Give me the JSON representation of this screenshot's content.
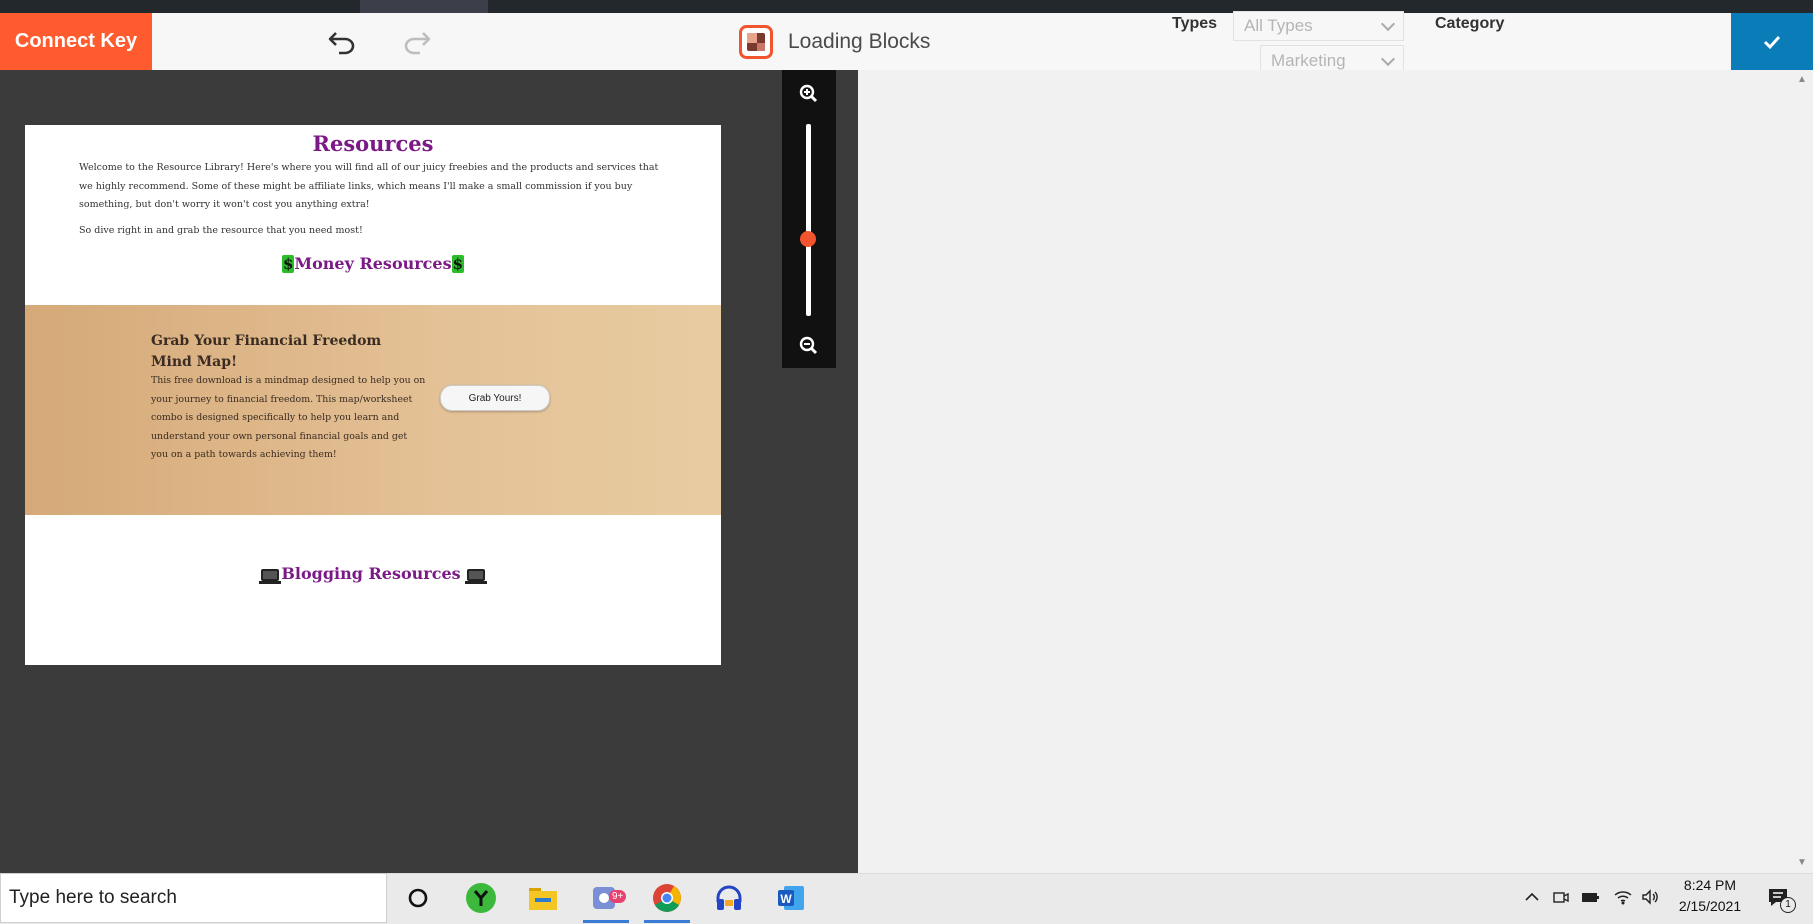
{
  "toolbar": {
    "connect_label": "Connect Key",
    "title": "Loading Blocks",
    "types_label": "Types",
    "types_value": "All Types",
    "category_label": "Category",
    "category_value": "Marketing",
    "undo_icon": "undo-icon",
    "redo_icon": "redo-icon",
    "confirm_icon": "checkmark-icon"
  },
  "preview": {
    "title": "Resources",
    "intro": "Welcome to the Resource Library! Here's where you will find all of our juicy freebies and the products and services that we highly recommend. Some of these might be affiliate links, which means I'll make a small commission if you buy something, but don't worry it won't cost you anything extra!",
    "dive": "So dive right in and grab the resource that you need most!",
    "money_heading": "Money Resources",
    "card_title": "Grab Your Financial Freedom Mind Map!",
    "card_description": "This free download is a mindmap designed to help you on your journey to financial freedom. This map/worksheet combo is designed specifically to help you learn and understand your own personal financial goals and get you on a path towards achieving them!",
    "card_button": "Grab Yours!",
    "blogging_heading": "Blogging Resources"
  },
  "zoom": {
    "zoom_in_icon": "zoom-in-icon",
    "zoom_out_icon": "zoom-out-icon",
    "level": 0.4
  },
  "taskbar": {
    "search_placeholder": "Type here to search",
    "apps": [
      "cortana-icon",
      "app-green-icon",
      "file-explorer-icon",
      "app-badge-icon",
      "chrome-icon",
      "headphones-app-icon",
      "word-icon"
    ],
    "badge_text": "9+",
    "time": "8:24 PM",
    "date": "2/15/2021",
    "notification_count": "1"
  },
  "colors": {
    "accent_orange": "#ff5b2e",
    "accent_blue": "#0a7cb7",
    "heading_purple": "#7b1a87"
  }
}
